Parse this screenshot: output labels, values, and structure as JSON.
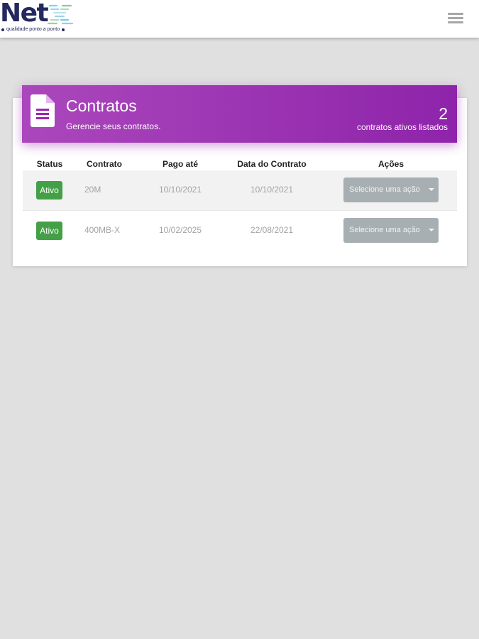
{
  "brand": {
    "name": "Net",
    "tagline": "qualidade ponto a ponto"
  },
  "header": {
    "menu_icon": "hamburger-menu-icon"
  },
  "contracts_card": {
    "icon": "document-icon",
    "title": "Contratos",
    "subtitle": "Gerencie seus contratos.",
    "count": "2",
    "count_label": "contratos ativos listados",
    "accent_color": "#9c27b0"
  },
  "table": {
    "columns": [
      "Status",
      "Contrato",
      "Pago até",
      "Data do Contrato",
      "Ações"
    ],
    "rows": [
      {
        "status": "Ativo",
        "contrato": "20M",
        "pago_ate": "10/10/2021",
        "data_contrato": "10/10/2021",
        "acao": "Selecione uma ação"
      },
      {
        "status": "Ativo",
        "contrato": "400MB-X",
        "pago_ate": "10/02/2025",
        "data_contrato": "22/08/2021",
        "acao": "Selecione uma ação"
      }
    ],
    "status_color": "#43a047"
  }
}
